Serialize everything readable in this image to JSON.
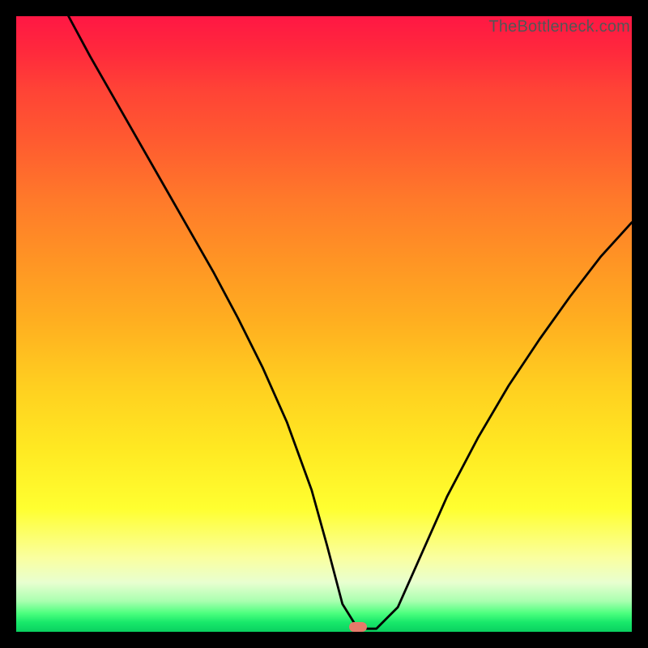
{
  "watermark": "TheBottleneck.com",
  "marker": {
    "x_frac": 0.555,
    "y_frac": 0.992
  },
  "chart_data": {
    "type": "line",
    "title": "",
    "xlabel": "",
    "ylabel": "",
    "xlim": [
      0,
      1
    ],
    "ylim": [
      0,
      1
    ],
    "series": [
      {
        "name": "curve",
        "x": [
          0.085,
          0.12,
          0.16,
          0.2,
          0.24,
          0.28,
          0.32,
          0.36,
          0.4,
          0.44,
          0.48,
          0.505,
          0.53,
          0.555,
          0.585,
          0.62,
          0.66,
          0.7,
          0.75,
          0.8,
          0.85,
          0.9,
          0.95,
          1.0
        ],
        "y": [
          1.0,
          0.935,
          0.865,
          0.795,
          0.725,
          0.655,
          0.585,
          0.51,
          0.43,
          0.34,
          0.23,
          0.14,
          0.045,
          0.005,
          0.005,
          0.04,
          0.13,
          0.22,
          0.315,
          0.4,
          0.475,
          0.545,
          0.61,
          0.665
        ]
      }
    ],
    "background_gradient": [
      {
        "pos": 0.0,
        "color": "#ff1744"
      },
      {
        "pos": 0.2,
        "color": "#ff5a30"
      },
      {
        "pos": 0.4,
        "color": "#ff9524"
      },
      {
        "pos": 0.6,
        "color": "#ffcf20"
      },
      {
        "pos": 0.8,
        "color": "#ffff30"
      },
      {
        "pos": 0.95,
        "color": "#aaffb0"
      },
      {
        "pos": 1.0,
        "color": "#0ad060"
      }
    ]
  }
}
